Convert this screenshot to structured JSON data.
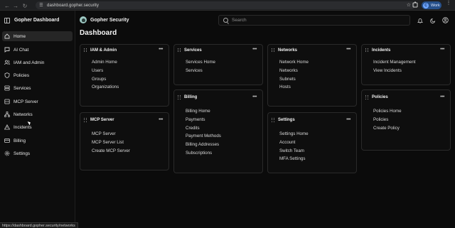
{
  "browser": {
    "url": "dashboard.gopher.security",
    "profile_label": "Work",
    "profile_initial": "C",
    "status_url": "https://dashboard.gopher.security/networks"
  },
  "sidebar": {
    "title": "Gopher Dashboard",
    "items": [
      {
        "label": "Home",
        "icon": "home-icon",
        "active": true
      },
      {
        "label": "AI Chat",
        "icon": "chat-icon"
      },
      {
        "label": "IAM and Admin",
        "icon": "users-icon"
      },
      {
        "label": "Policies",
        "icon": "shield-icon"
      },
      {
        "label": "Services",
        "icon": "server-icon"
      },
      {
        "label": "MCP Server",
        "icon": "mcp-server-icon"
      },
      {
        "label": "Networks",
        "icon": "network-icon"
      },
      {
        "label": "Incidents",
        "icon": "alert-triangle-icon"
      },
      {
        "label": "Billing",
        "icon": "credit-card-icon"
      },
      {
        "label": "Settings",
        "icon": "gear-icon"
      }
    ]
  },
  "header": {
    "brand": "Gopher Security",
    "search_placeholder": "Search"
  },
  "page_title": "Dashboard",
  "cards": {
    "iam": {
      "title": "IAM & Admin",
      "links": [
        "Admin Home",
        "Users",
        "Groups",
        "Organizations"
      ]
    },
    "mcp": {
      "title": "MCP Server",
      "links": [
        "MCP Server",
        "MCP Server List",
        "Create MCP Server"
      ]
    },
    "services": {
      "title": "Services",
      "links": [
        "Services Home",
        "Services"
      ]
    },
    "billing": {
      "title": "Billing",
      "links": [
        "Billing Home",
        "Payments",
        "Credits",
        "Payment Methods",
        "Billing Addresses",
        "Subscriptions"
      ]
    },
    "networks": {
      "title": "Networks",
      "links": [
        "Network Home",
        "Networks",
        "Subnets",
        "Hosts"
      ]
    },
    "settings": {
      "title": "Settings",
      "links": [
        "Settings Home",
        "Account",
        "Switch Team",
        "MFA Settings"
      ]
    },
    "incidents": {
      "title": "Incidents",
      "links": [
        "Incident Management",
        "View Incidents"
      ]
    },
    "policies": {
      "title": "Policies",
      "links": [
        "Policies Home",
        "Policies",
        "Create Policy"
      ]
    }
  }
}
